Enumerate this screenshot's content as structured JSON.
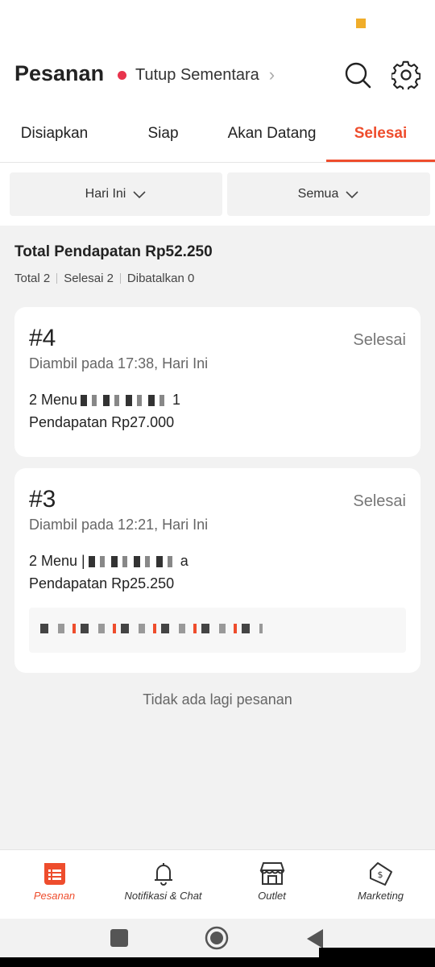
{
  "header": {
    "title": "Pesanan",
    "store_status": "Tutup Sementara",
    "status_color": "#e8344d"
  },
  "tabs": [
    {
      "label": "Disiapkan"
    },
    {
      "label": "Siap"
    },
    {
      "label": "Akan Datang"
    },
    {
      "label": "Selesai",
      "active": true
    }
  ],
  "filters": {
    "date": "Hari Ini",
    "type": "Semua"
  },
  "summary": {
    "title": "Total Pendapatan Rp52.250",
    "total": "Total 2",
    "done": "Selesai 2",
    "cancelled": "Dibatalkan 0"
  },
  "orders": [
    {
      "number": "#4",
      "status": "Selesai",
      "pickup": "Diambil pada 17:38, Hari Ini",
      "menu_prefix": "2 Menu",
      "menu_suffix": "1",
      "income": "Pendapatan Rp27.000"
    },
    {
      "number": "#3",
      "status": "Selesai",
      "pickup": "Diambil pada 12:21, Hari Ini",
      "menu_prefix": "2 Menu |",
      "menu_suffix": "a",
      "income": "Pendapatan Rp25.250"
    }
  ],
  "empty_message": "Tidak ada lagi pesanan",
  "bottom_nav": [
    {
      "label": "Pesanan",
      "icon": "orders-icon",
      "active": true
    },
    {
      "label": "Notifikasi & Chat",
      "icon": "bell-icon"
    },
    {
      "label": "Outlet",
      "icon": "store-icon"
    },
    {
      "label": "Marketing",
      "icon": "tag-icon"
    }
  ],
  "colors": {
    "accent": "#ee4d2d",
    "background": "#f2f2f2"
  }
}
